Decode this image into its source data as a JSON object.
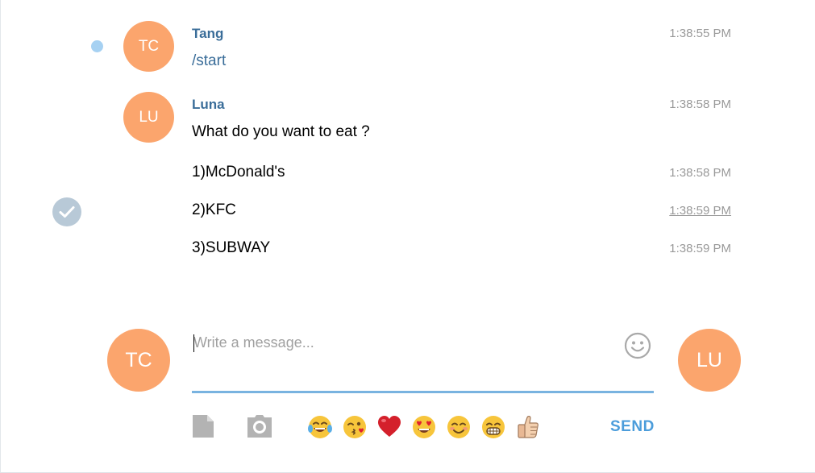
{
  "messages": [
    {
      "sender": "Tang",
      "avatar": "TC",
      "text": "/start",
      "time": "1:38:55 PM"
    },
    {
      "sender": "Luna",
      "avatar": "LU",
      "text": "What do you want to eat ?",
      "time": "1:38:58 PM"
    },
    {
      "text": "1)McDonald's",
      "time": "1:38:58 PM"
    },
    {
      "text": "2)KFC",
      "time": "1:38:59 PM"
    },
    {
      "text": "3)SUBWAY",
      "time": "1:38:59 PM"
    }
  ],
  "composer": {
    "placeholder": "Write a message...",
    "value": "",
    "left_avatar": "TC",
    "right_avatar": "LU",
    "send_label": "SEND"
  },
  "emoji_bar": [
    {
      "name": "tears-of-joy",
      "icon": "laughing-tears-emoji"
    },
    {
      "name": "kissing-face",
      "icon": "kiss-wink-emoji"
    },
    {
      "name": "red-heart",
      "icon": "heart-emoji"
    },
    {
      "name": "heart-eyes",
      "icon": "heart-eyes-emoji"
    },
    {
      "name": "smiling-face",
      "icon": "smile-emoji"
    },
    {
      "name": "grinning-face",
      "icon": "grin-emoji"
    },
    {
      "name": "thumbs-up",
      "icon": "thumbs-up-emoji"
    }
  ],
  "colors": {
    "avatar": "#fba56d",
    "sender": "#3a6d99",
    "accent": "#4c9ddb",
    "input_underline": "#79b3e0",
    "timestamp": "#999999",
    "unread_dot": "#a6d1f2"
  }
}
